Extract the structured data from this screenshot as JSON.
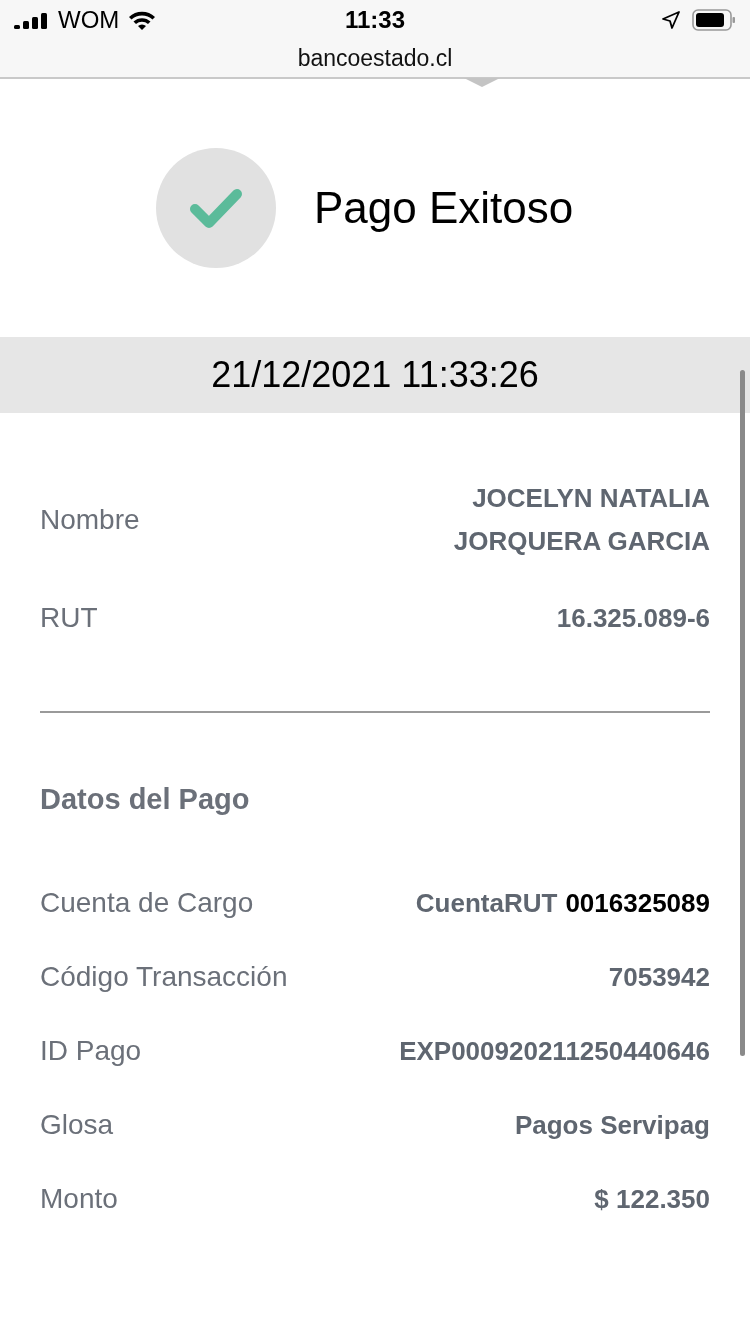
{
  "status_bar": {
    "carrier": "WOM",
    "time": "11:33"
  },
  "browser": {
    "url": "bancoestado.cl"
  },
  "result": {
    "title": "Pago Exitoso"
  },
  "timestamp": "21/12/2021 11:33:26",
  "holder": [
    {
      "label": "Nombre",
      "value": "JOCELYN NATALIA\nJORQUERA GARCIA"
    },
    {
      "label": "RUT",
      "value": "16.325.089-6"
    }
  ],
  "payment": {
    "heading": "Datos del Pago",
    "rows": [
      {
        "kind": "account",
        "label": "Cuenta de Cargo",
        "product": "CuentaRUT",
        "number": "0016325089"
      },
      {
        "kind": "plain",
        "label": "Código Transacción",
        "value": "7053942"
      },
      {
        "kind": "plain",
        "label": "ID Pago",
        "value": "EXP000920211250440646"
      },
      {
        "kind": "plain",
        "label": "Glosa",
        "value": "Pagos Servipag"
      },
      {
        "kind": "plain",
        "label": "Monto",
        "value": "$ 122.350"
      }
    ]
  }
}
